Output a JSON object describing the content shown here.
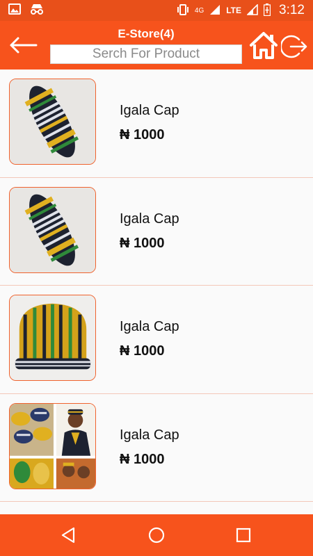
{
  "status_bar": {
    "time": "3:12",
    "network": "4G",
    "lte": "LTE",
    "icons": [
      "image-icon",
      "incognito-icon",
      "vibrate-icon",
      "signal-icon",
      "battery-icon"
    ]
  },
  "header": {
    "title": "E-Store(4)",
    "search_placeholder": "Serch For Product",
    "icons": [
      "back-arrow-icon",
      "home-icon",
      "logout-icon"
    ]
  },
  "products": [
    {
      "name": "Igala Cap",
      "price": "₦ 1000",
      "image": "cap-folded"
    },
    {
      "name": "Igala Cap",
      "price": "₦ 1000",
      "image": "cap-folded"
    },
    {
      "name": "Igala Cap",
      "price": "₦ 1000",
      "image": "cap-round"
    },
    {
      "name": "Igala Cap",
      "price": "₦ 1000",
      "image": "cap-collage"
    }
  ],
  "nav": {
    "icons": [
      "back-triangle-icon",
      "home-circle-icon",
      "recents-square-icon"
    ]
  },
  "colors": {
    "accent": "#f7531c",
    "status_bar": "#e8501a",
    "thumb_border": "#f0622d"
  }
}
